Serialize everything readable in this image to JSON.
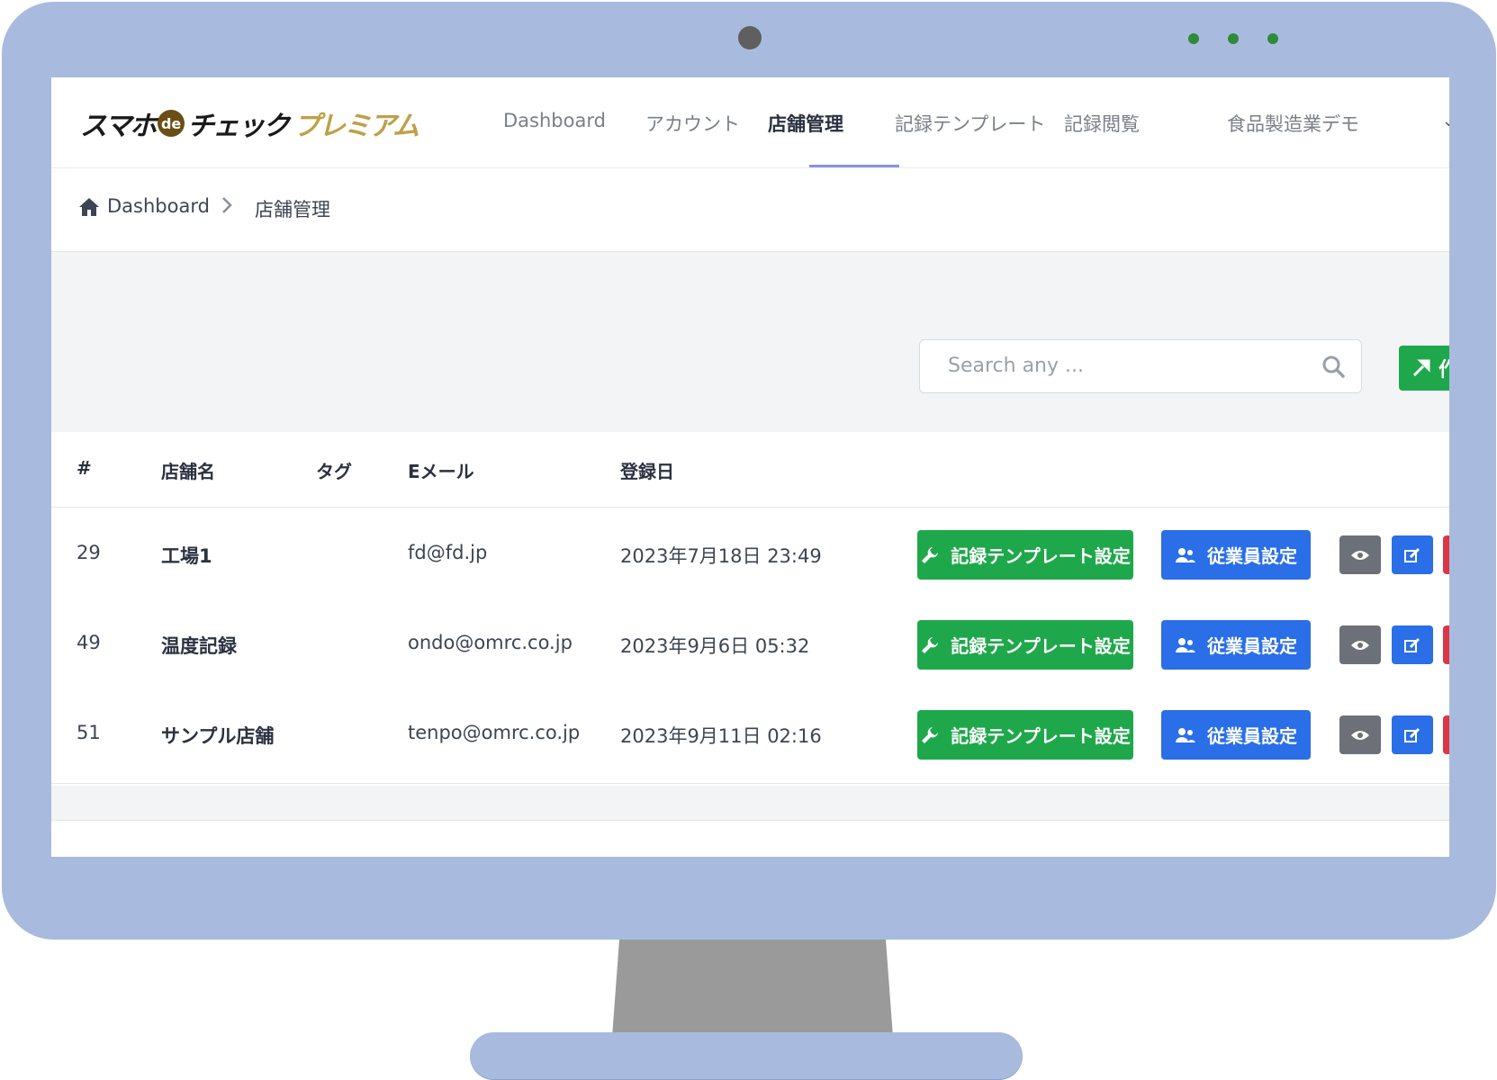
{
  "logo": {
    "part1": "スマホ",
    "badge": "de",
    "part2": "チェック",
    "part3": "プレミアム"
  },
  "nav": {
    "items": [
      {
        "label": "Dashboard"
      },
      {
        "label": "アカウント"
      },
      {
        "label": "店舗管理",
        "active": true
      },
      {
        "label": "記録テンプレート"
      },
      {
        "label": "記録閲覧"
      },
      {
        "label": "食品製造業デモ"
      }
    ],
    "accent": "#8a92e6"
  },
  "breadcrumb": {
    "home": "Dashboard",
    "current": "店舗管理",
    "separator": ">"
  },
  "search": {
    "placeholder": "Search any ..."
  },
  "create_button": {
    "label": "作"
  },
  "table": {
    "headers": {
      "id": "#",
      "name": "店舗名",
      "tag": "タグ",
      "email": "Eメール",
      "date": "登録日"
    },
    "rows": [
      {
        "id": "29",
        "name": "工場1",
        "tag": "",
        "email": "fd@fd.jp",
        "date": "2023年7月18日 23:49"
      },
      {
        "id": "49",
        "name": "温度記録",
        "tag": "",
        "email": "ondo@omrc.co.jp",
        "date": "2023年9月6日 05:32"
      },
      {
        "id": "51",
        "name": "サンプル店舗",
        "tag": "",
        "email": "tenpo@omrc.co.jp",
        "date": "2023年9月11日 02:16"
      }
    ],
    "actions": {
      "template": "記録テンプレート設定",
      "employee": "従業員設定"
    }
  },
  "colors": {
    "green": "#1fa84b",
    "blue": "#2a6ee8",
    "gray": "#6c7078",
    "red": "#dc3545",
    "frame": "#a8bbde"
  }
}
